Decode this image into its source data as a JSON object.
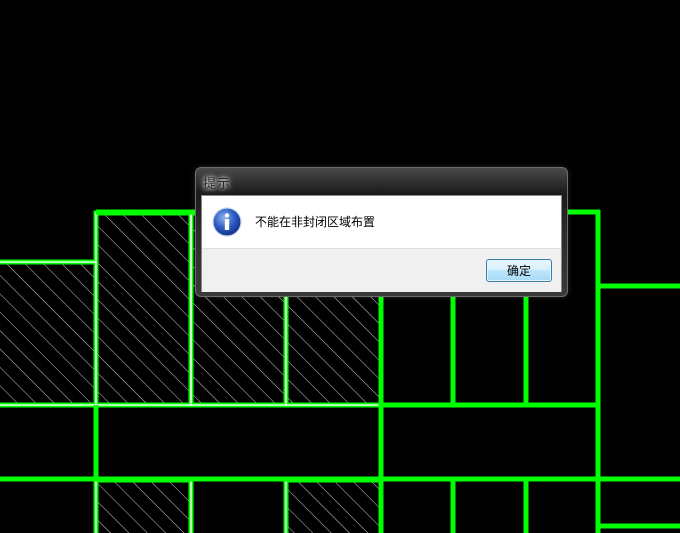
{
  "background": {
    "canvas_color": "#000000",
    "line_color": "#00ff00",
    "hatch_color": "#ffffff"
  },
  "dialog": {
    "title": "提示",
    "message": "不能在非封闭区域布置",
    "icon": "info-icon",
    "ok_label": "确定"
  }
}
